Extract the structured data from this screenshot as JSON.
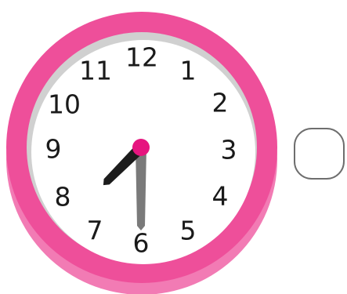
{
  "clock": {
    "numerals": [
      "12",
      "1",
      "2",
      "3",
      "4",
      "5",
      "6",
      "7",
      "8",
      "9",
      "10",
      "11"
    ],
    "time": {
      "hour": 7,
      "minute": 30
    },
    "colors": {
      "rim": "#ee4f9a",
      "rim_shadow": "#f27bb4",
      "inner_shadow": "#d0d0d0",
      "face": "#ffffff",
      "hour_hand": "#1c1c1c",
      "minute_hand": "#7a7a7a",
      "center_pin": "#e6157f"
    }
  },
  "answer_box": {
    "value": "",
    "border_color": "#6e6e6e"
  }
}
